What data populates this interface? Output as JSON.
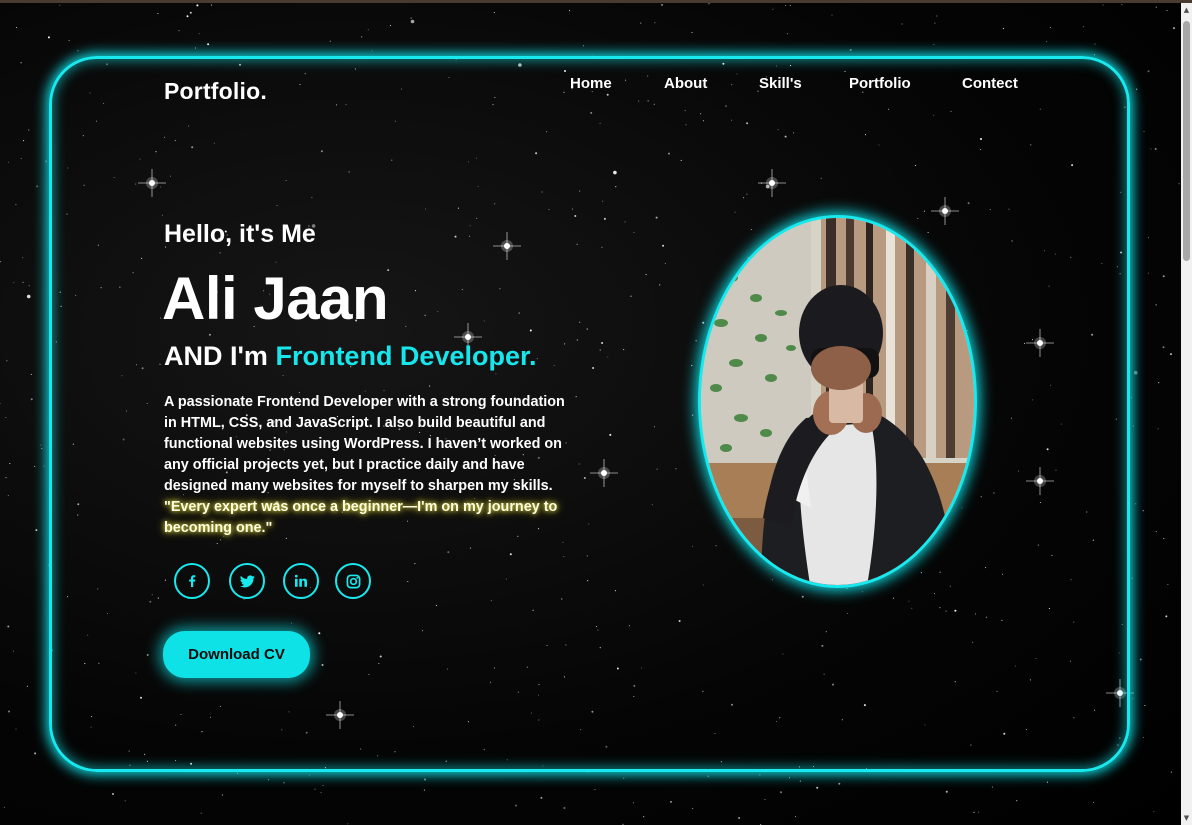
{
  "logo": "Portfolio.",
  "nav": [
    "Home",
    "About",
    "Skill's",
    "Portfolio",
    "Contect"
  ],
  "hero": {
    "greeting": "Hello, it's Me",
    "name": "Ali Jaan",
    "role_prefix": "AND I'm",
    "role_accent": "Frontend Developer.",
    "bio": "A passionate Frontend Developer with a strong foundation in HTML, CSS, and JavaScript. I also build beautiful and functional websites using WordPress. I haven’t worked on any official projects yet, but I practice daily and have designed many websites for myself to sharpen my skills.",
    "quote": "\"Every expert was once a beginner—I'm on my journey to becoming one.\"",
    "cv_button": "Download CV"
  },
  "socials": [
    {
      "icon": "facebook-icon",
      "glyph": "f"
    },
    {
      "icon": "twitter-icon",
      "glyph": "🐦"
    },
    {
      "icon": "linkedin-icon",
      "glyph": "in"
    },
    {
      "icon": "instagram-icon",
      "glyph": "◎"
    }
  ],
  "colors": {
    "accent": "#18e9ee",
    "background": "#000000",
    "quote_glow": "#e5e04a"
  }
}
